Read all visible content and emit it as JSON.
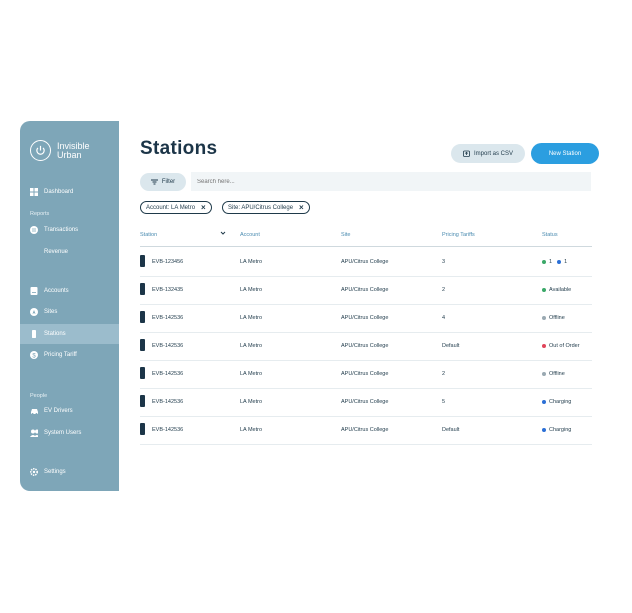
{
  "brand": {
    "line1": "Invisible",
    "line2": "Urban"
  },
  "sidebar": {
    "dashboard": "Dashboard",
    "reports_label": "Reports",
    "transactions": "Transactions",
    "revenue": "Revenue",
    "accounts": "Accounts",
    "sites": "Sites",
    "stations": "Stations",
    "pricing": "Pricing Tariff",
    "people_label": "People",
    "ev_drivers": "EV Drivers",
    "system_users": "System Users",
    "settings": "Settings"
  },
  "page": {
    "title": "Stations"
  },
  "actions": {
    "import_csv": "Import as CSV",
    "new_station": "New Station"
  },
  "filter": {
    "label": "Filter",
    "search_placeholder": "Search here..."
  },
  "chips": [
    "Account: LA Metro",
    "Site: APU/Citrus College"
  ],
  "table": {
    "headers": [
      "Station",
      "Account",
      "Site",
      "Pricing Tariffs",
      "Status"
    ],
    "rows": [
      {
        "station": "EVB-123456",
        "account": "LA Metro",
        "site": "APU/Citrus College",
        "tariff": "3",
        "status": "1",
        "status2": "1",
        "color": "#3aa868",
        "color2": "#2b6fd6"
      },
      {
        "station": "EVB-132435",
        "account": "LA Metro",
        "site": "APU/Citrus College",
        "tariff": "2",
        "status": "Available",
        "color": "#3aa868"
      },
      {
        "station": "EVB-142536",
        "account": "LA Metro",
        "site": "APU/Citrus College",
        "tariff": "4",
        "status": "Offline",
        "color": "#9aa9b2"
      },
      {
        "station": "EVB-142536",
        "account": "LA Metro",
        "site": "APU/Citrus College",
        "tariff": "Default",
        "status": "Out of Order",
        "color": "#e0445a"
      },
      {
        "station": "EVB-142536",
        "account": "LA Metro",
        "site": "APU/Citrus College",
        "tariff": "2",
        "status": "Offline",
        "color": "#9aa9b2"
      },
      {
        "station": "EVB-142536",
        "account": "LA Metro",
        "site": "APU/Citrus College",
        "tariff": "5",
        "status": "Charging",
        "color": "#2b6fd6"
      },
      {
        "station": "EVB-142536",
        "account": "LA Metro",
        "site": "APU/Citrus College",
        "tariff": "Default",
        "status": "Charging",
        "color": "#2b6fd6"
      }
    ]
  }
}
